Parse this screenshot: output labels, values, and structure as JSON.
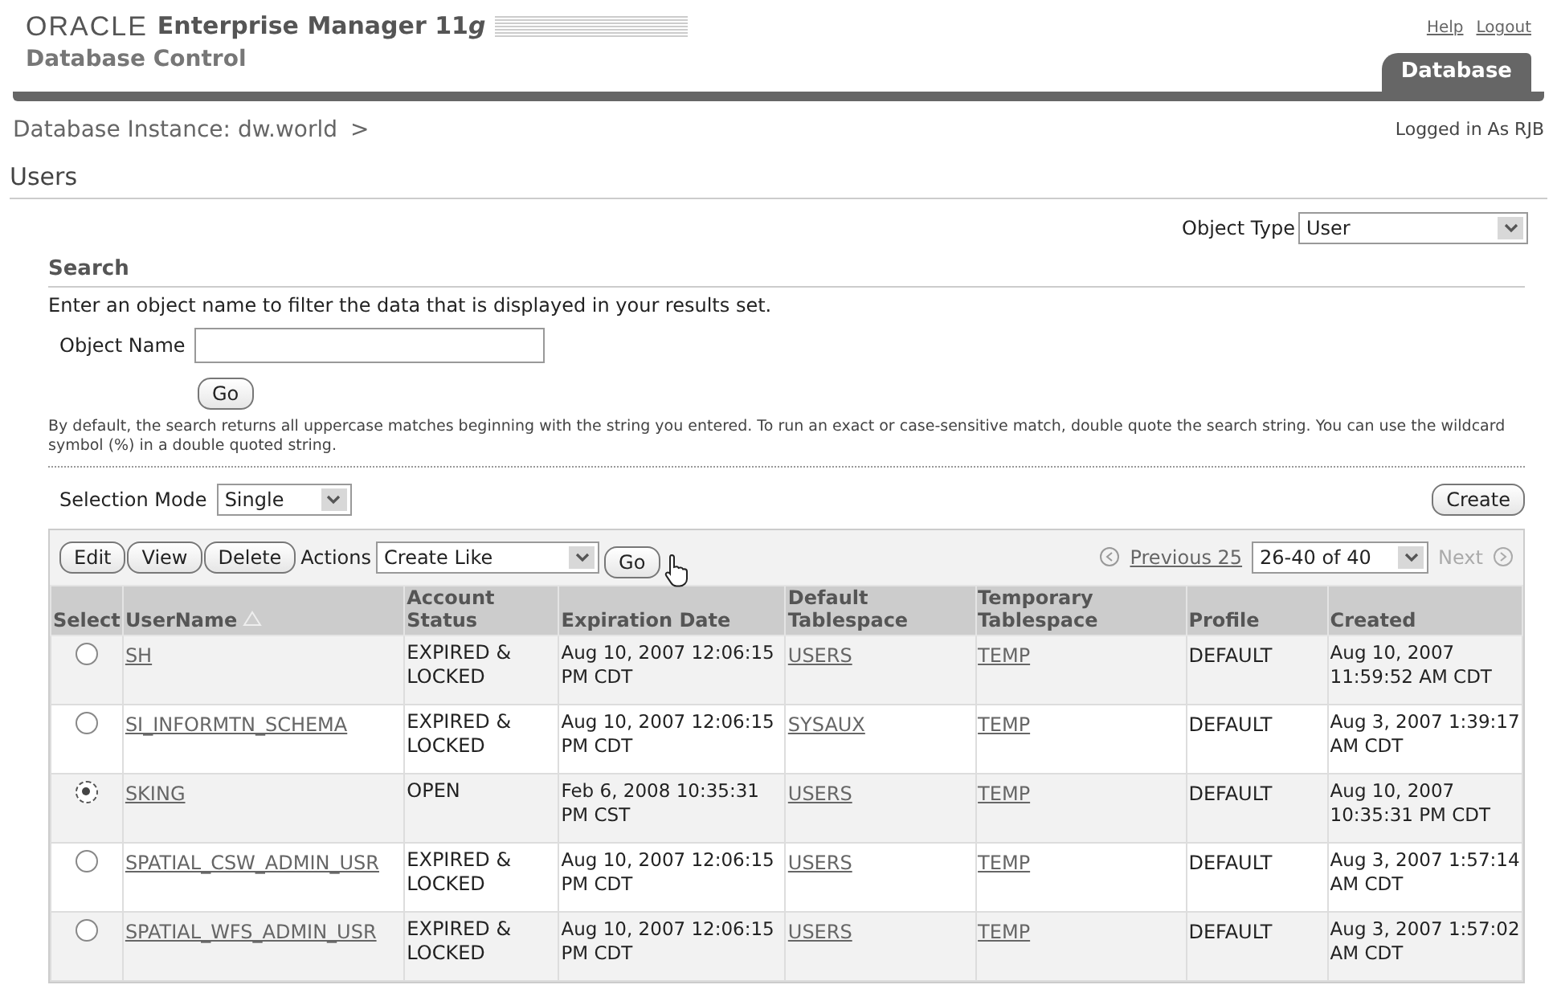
{
  "header": {
    "logo": "ORACLE",
    "product": "Enterprise Manager 11",
    "product_suffix": "g",
    "subtitle": "Database Control",
    "links": [
      "Help",
      "Logout"
    ],
    "tab": "Database"
  },
  "breadcrumb": {
    "text": "Database Instance: dw.world",
    "separator": ">"
  },
  "login_status": "Logged in As RJB",
  "page_title": "Users",
  "object_type": {
    "label": "Object Type",
    "value": "User"
  },
  "search": {
    "title": "Search",
    "instruction": "Enter an object name to filter the data that is displayed in your results set.",
    "field_label": "Object Name",
    "button": "Go",
    "note": "By default, the search returns all uppercase matches beginning with the string you entered. To run an exact or case-sensitive match, double quote the search string. You can use the wildcard symbol (%) in a double quoted string."
  },
  "selection_mode": {
    "label": "Selection Mode",
    "value": "Single"
  },
  "create_button": "Create",
  "toolbar": {
    "buttons": [
      "Edit",
      "View",
      "Delete"
    ],
    "actions_label": "Actions",
    "actions_value": "Create Like",
    "go_button": "Go",
    "previous": "Previous 25",
    "range": "26-40 of 40",
    "next": "Next"
  },
  "table": {
    "columns": [
      "Select",
      "UserName",
      "Account Status",
      "Expiration Date",
      "Default Tablespace",
      "Temporary Tablespace",
      "Profile",
      "Created"
    ],
    "rows": [
      {
        "selected": false,
        "username": "SH",
        "account_status": "EXPIRED & LOCKED",
        "expiration_date": "Aug 10, 2007 12:06:15 PM CDT",
        "default_tablespace": "USERS",
        "temporary_tablespace": "TEMP",
        "profile": "DEFAULT",
        "created": "Aug 10, 2007 11:59:52 AM CDT"
      },
      {
        "selected": false,
        "username": "SI_INFORMTN_SCHEMA",
        "account_status": "EXPIRED & LOCKED",
        "expiration_date": "Aug 10, 2007 12:06:15 PM CDT",
        "default_tablespace": "SYSAUX",
        "temporary_tablespace": "TEMP",
        "profile": "DEFAULT",
        "created": "Aug 3, 2007 1:39:17 AM CDT"
      },
      {
        "selected": true,
        "username": "SKING",
        "account_status": "OPEN",
        "expiration_date": "Feb 6, 2008 10:35:31 PM CST",
        "default_tablespace": "USERS",
        "temporary_tablespace": "TEMP",
        "profile": "DEFAULT",
        "created": "Aug 10, 2007 10:35:31 PM CDT"
      },
      {
        "selected": false,
        "username": "SPATIAL_CSW_ADMIN_USR",
        "account_status": "EXPIRED & LOCKED",
        "expiration_date": "Aug 10, 2007 12:06:15 PM CDT",
        "default_tablespace": "USERS",
        "temporary_tablespace": "TEMP",
        "profile": "DEFAULT",
        "created": "Aug 3, 2007 1:57:14 AM CDT"
      },
      {
        "selected": false,
        "username": "SPATIAL_WFS_ADMIN_USR",
        "account_status": "EXPIRED & LOCKED",
        "expiration_date": "Aug 10, 2007 12:06:15 PM CDT",
        "default_tablespace": "USERS",
        "temporary_tablespace": "TEMP",
        "profile": "DEFAULT",
        "created": "Aug 3, 2007 1:57:02 AM CDT"
      }
    ]
  }
}
